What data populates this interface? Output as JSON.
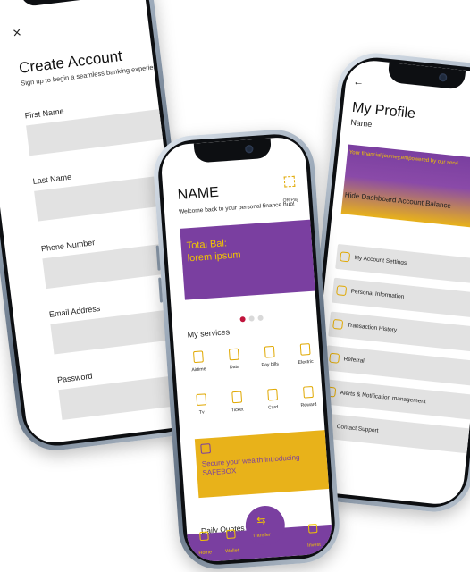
{
  "create_account": {
    "close_glyph": "×",
    "title": "Create Account",
    "subtitle": "Sign up to begin a seamless banking experience",
    "fields": [
      {
        "label": "First Name",
        "value": ""
      },
      {
        "label": "Last Name",
        "value": ""
      },
      {
        "label": "Phone Number",
        "value": ""
      },
      {
        "label": "Email Address",
        "value": ""
      },
      {
        "label": "Password",
        "value": ""
      }
    ]
  },
  "dashboard": {
    "name": "NAME",
    "welcome": "Welcome back to your personal finance hub!",
    "qr_label": "QR Pay",
    "balance_label": "Total Bal:",
    "balance_value": "lorem ipsum",
    "services_title": "My services",
    "services": [
      {
        "label": "Airtime",
        "icon": "phone-icon"
      },
      {
        "label": "Data",
        "icon": "data-icon"
      },
      {
        "label": "Pay bills",
        "icon": "bill-icon"
      },
      {
        "label": "Electric",
        "icon": "bulb-icon"
      },
      {
        "label": "Tv",
        "icon": "tv-icon"
      },
      {
        "label": "Ticket",
        "icon": "ticket-icon"
      },
      {
        "label": "Card",
        "icon": "card-icon"
      },
      {
        "label": "Reward",
        "icon": "reward-icon"
      }
    ],
    "safebox_text": "Secure your wealth:introducing SAFEBOX",
    "quotes_title": "Daily Quotes",
    "nav": {
      "home": "Home",
      "wallet": "Wallet",
      "transfer": "Transfer",
      "invest": "Invest"
    },
    "colors": {
      "primary": "#7a3fa0",
      "accent": "#f2c500",
      "gold": "#e8b21a"
    }
  },
  "profile": {
    "back_glyph": "←",
    "title": "My Profile",
    "name": "Name",
    "banner_tagline": "Your financial journey,empowered by our servi",
    "hide_balance": "Hide Dashboard Account Balance",
    "menu": [
      {
        "label": "My Account Settings",
        "icon": "gear-icon"
      },
      {
        "label": "Personal Information",
        "icon": "user-icon"
      },
      {
        "label": "Transaction History",
        "icon": "history-icon"
      },
      {
        "label": "Referral",
        "icon": "share-icon"
      },
      {
        "label": "Alerts & Notification management",
        "icon": "bell-icon"
      },
      {
        "label": "Contact Support",
        "icon": "headset-icon"
      }
    ]
  }
}
